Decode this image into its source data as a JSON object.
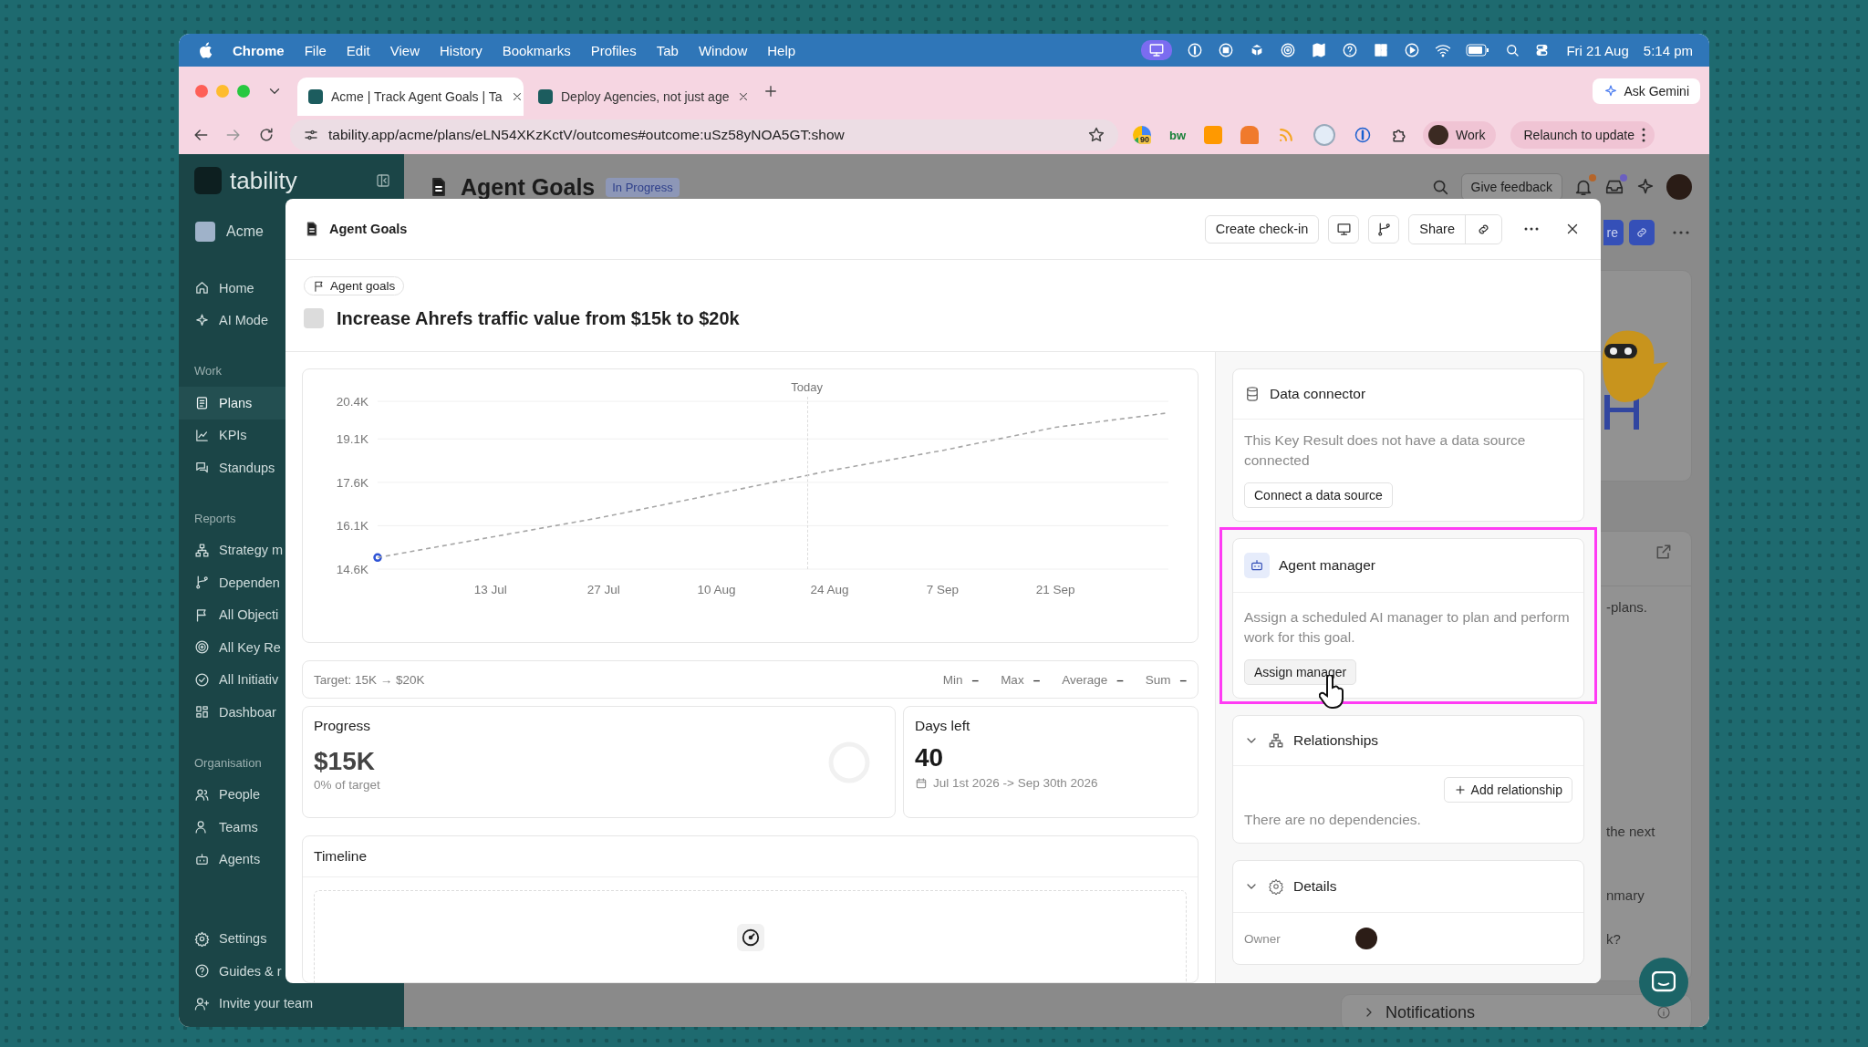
{
  "menu_bar": {
    "app": "Chrome",
    "items": [
      "File",
      "Edit",
      "View",
      "History",
      "Bookmarks",
      "Profiles",
      "Tab",
      "Window",
      "Help"
    ],
    "date": "Fri 21 Aug",
    "time": "5:14 pm"
  },
  "browser_tabs": [
    {
      "title": "Acme | Track Agent Goals | Ta",
      "selected": true
    },
    {
      "title": "Deploy Agencies, not just age",
      "selected": false
    }
  ],
  "ask_gemini": "Ask Gemini",
  "url": "tability.app/acme/plans/eLN54XKzKctV/outcomes#outcome:uSz58yNOA5GT:show",
  "extensions": {
    "badge": "90",
    "label": "bw"
  },
  "profile": "Work",
  "relaunch": "Relaunch to update",
  "sidebar": {
    "logo": "tability",
    "workspace": "Acme",
    "sections": [
      {
        "items": [
          {
            "label": "Home",
            "selected": false
          },
          {
            "label": "AI Mode",
            "selected": false
          }
        ]
      },
      {
        "heading": "Work",
        "items": [
          {
            "label": "Plans",
            "selected": true
          },
          {
            "label": "KPIs",
            "selected": false
          },
          {
            "label": "Standups",
            "selected": false
          }
        ]
      },
      {
        "heading": "Reports",
        "items": [
          {
            "label": "Strategy m",
            "selected": false
          },
          {
            "label": "Dependen",
            "selected": false
          },
          {
            "label": "All Objecti",
            "selected": false
          },
          {
            "label": "All Key Re",
            "selected": false
          },
          {
            "label": "All Initiativ",
            "selected": false
          },
          {
            "label": "Dashboar",
            "selected": false
          }
        ]
      },
      {
        "heading": "Organisation",
        "items": [
          {
            "label": "People",
            "selected": false
          },
          {
            "label": "Teams",
            "selected": false
          },
          {
            "label": "Agents",
            "selected": false
          }
        ]
      }
    ],
    "footer": [
      {
        "label": "Settings",
        "selected": false
      },
      {
        "label": "Guides & r",
        "selected": false
      },
      {
        "label": "Invite your team",
        "selected": false
      }
    ]
  },
  "page": {
    "title": "Agent Goals",
    "status": "In Progress",
    "feedback_button": "Give feedback",
    "share_fragment": "re",
    "side_texts": [
      "-plans.",
      "the next",
      "nmary",
      "k?"
    ],
    "notifications": "Notifications"
  },
  "modal": {
    "title": "Agent Goals",
    "create_checkin": "Create check-in",
    "share": "Share",
    "tag": "Agent goals",
    "goal": {
      "title": "Increase Ahrefs traffic value from $15k to $20k",
      "checked": false
    },
    "chart_data": {
      "type": "line",
      "grid": true,
      "categories": [
        null,
        "13 Jul",
        "27 Jul",
        "10 Aug",
        "24 Aug",
        "7 Sep",
        "21 Sep",
        null
      ],
      "ylim": [
        14600,
        20400
      ],
      "yticks": [
        {
          "value": 14600,
          "label": "14.6K"
        },
        {
          "value": 16100,
          "label": "16.1K"
        },
        {
          "value": 17600,
          "label": "17.6K"
        },
        {
          "value": 19100,
          "label": "19.1K"
        },
        {
          "value": 20400,
          "label": "20.4K"
        }
      ],
      "series": [
        {
          "color": "#a6a6a6",
          "line_style": "dashed",
          "values": [
            15000,
            15700,
            16400,
            17200,
            18000,
            18700,
            19500,
            20000
          ]
        },
        {
          "color": "#2f54d6",
          "marker": "circle",
          "values": [
            15000,
            null,
            null,
            null,
            null,
            null,
            null,
            null
          ]
        }
      ],
      "annotations": [
        "Today"
      ]
    },
    "target": "Target: 15K → $20K",
    "stats": [
      {
        "label": "Min",
        "value": "–"
      },
      {
        "label": "Max",
        "value": "–"
      },
      {
        "label": "Average",
        "value": "–"
      },
      {
        "label": "Sum",
        "value": "–"
      }
    ],
    "progress": {
      "label": "Progress",
      "value": "$15K",
      "caption": "0% of target",
      "level": 0
    },
    "days_left": {
      "label": "Days left",
      "value": "40",
      "range": "Jul 1st 2026 -> Sep 30th 2026"
    },
    "timeline": {
      "title": "Timeline"
    },
    "data_connector": {
      "title": "Data connector",
      "text": "This Key Result does not have a data source connected",
      "button": "Connect a data source"
    },
    "agent_manager": {
      "title": "Agent manager",
      "text": "Assign a scheduled AI manager to plan and perform work for this goal.",
      "button": "Assign manager",
      "highlighted": true
    },
    "relationships": {
      "title": "Relationships",
      "expanded": true,
      "button": "Add relationship",
      "empty_text": "There are no dependencies."
    },
    "details": {
      "title": "Details",
      "expanded": true,
      "owner_label": "Owner"
    }
  }
}
